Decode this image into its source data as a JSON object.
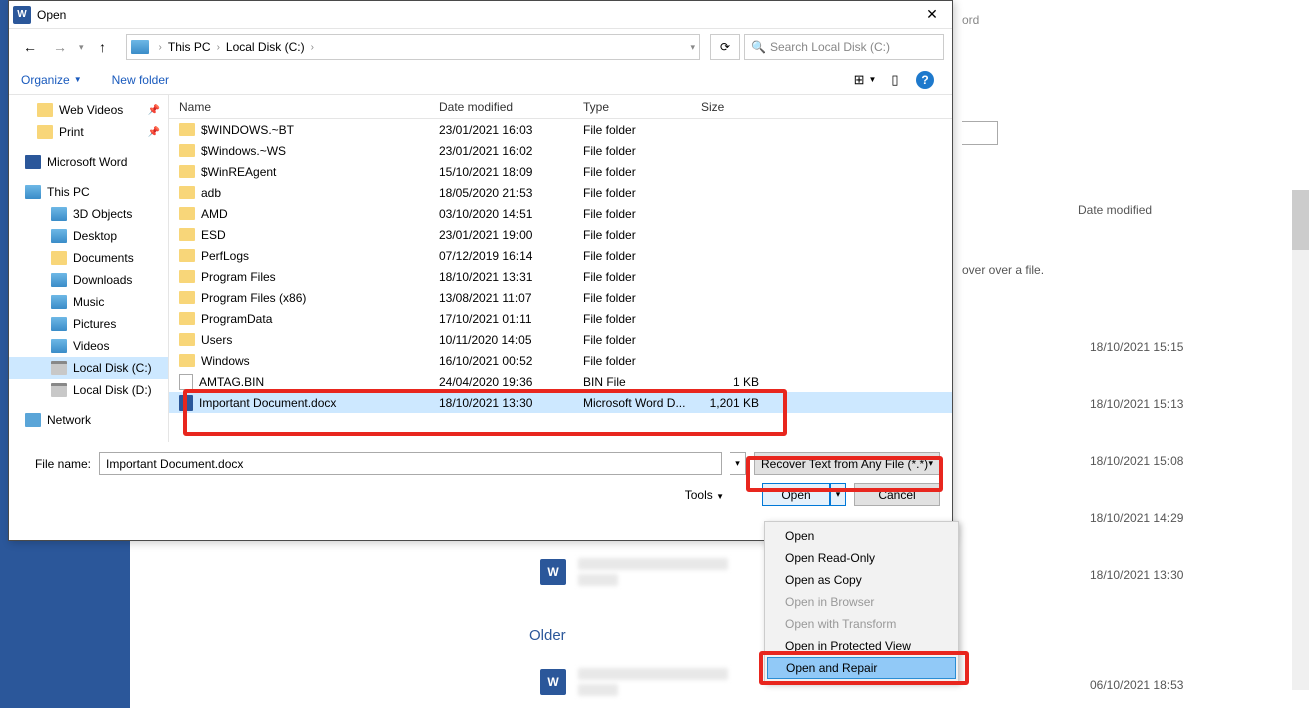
{
  "bg": {
    "app_hint": "ord",
    "col_header": "Date modified",
    "hover_text": "over over a file.",
    "dates": [
      "18/10/2021 15:15",
      "18/10/2021 15:13",
      "18/10/2021 15:08",
      "18/10/2021 14:29",
      "18/10/2021 13:30",
      "06/10/2021 18:53"
    ],
    "older": "Older"
  },
  "dialog": {
    "title": "Open",
    "breadcrumb": {
      "root": "This PC",
      "loc": "Local Disk (C:)"
    },
    "search_placeholder": "Search Local Disk (C:)",
    "toolbar": {
      "organize": "Organize",
      "newfolder": "New folder"
    },
    "columns": {
      "name": "Name",
      "date": "Date modified",
      "type": "Type",
      "size": "Size"
    },
    "tree": {
      "webvideos": "Web Videos",
      "print": "Print",
      "msword": "Microsoft Word",
      "thispc": "This PC",
      "obj3d": "3D Objects",
      "desktop": "Desktop",
      "documents": "Documents",
      "downloads": "Downloads",
      "music": "Music",
      "pictures": "Pictures",
      "videos": "Videos",
      "diskc": "Local Disk (C:)",
      "diskd": "Local Disk (D:)",
      "network": "Network"
    },
    "files": [
      {
        "name": "$WINDOWS.~BT",
        "date": "23/01/2021 16:03",
        "type": "File folder",
        "size": "",
        "icon": "folder"
      },
      {
        "name": "$Windows.~WS",
        "date": "23/01/2021 16:02",
        "type": "File folder",
        "size": "",
        "icon": "folder"
      },
      {
        "name": "$WinREAgent",
        "date": "15/10/2021 18:09",
        "type": "File folder",
        "size": "",
        "icon": "folder"
      },
      {
        "name": "adb",
        "date": "18/05/2020 21:53",
        "type": "File folder",
        "size": "",
        "icon": "folder"
      },
      {
        "name": "AMD",
        "date": "03/10/2020 14:51",
        "type": "File folder",
        "size": "",
        "icon": "folder"
      },
      {
        "name": "ESD",
        "date": "23/01/2021 19:00",
        "type": "File folder",
        "size": "",
        "icon": "folder"
      },
      {
        "name": "PerfLogs",
        "date": "07/12/2019 16:14",
        "type": "File folder",
        "size": "",
        "icon": "folder"
      },
      {
        "name": "Program Files",
        "date": "18/10/2021 13:31",
        "type": "File folder",
        "size": "",
        "icon": "folder"
      },
      {
        "name": "Program Files (x86)",
        "date": "13/08/2021 11:07",
        "type": "File folder",
        "size": "",
        "icon": "folder"
      },
      {
        "name": "ProgramData",
        "date": "17/10/2021 01:11",
        "type": "File folder",
        "size": "",
        "icon": "folder"
      },
      {
        "name": "Users",
        "date": "10/11/2020 14:05",
        "type": "File folder",
        "size": "",
        "icon": "folder"
      },
      {
        "name": "Windows",
        "date": "16/10/2021 00:52",
        "type": "File folder",
        "size": "",
        "icon": "folder"
      },
      {
        "name": "AMTAG.BIN",
        "date": "24/04/2020 19:36",
        "type": "BIN File",
        "size": "1 KB",
        "icon": "file"
      },
      {
        "name": "Important Document.docx",
        "date": "18/10/2021 13:30",
        "type": "Microsoft Word D...",
        "size": "1,201 KB",
        "icon": "word",
        "selected": true
      }
    ],
    "footer": {
      "filename_label": "File name:",
      "filename_value": "Important Document.docx",
      "filter": "Recover Text from Any File (*.*)",
      "tools": "Tools",
      "open": "Open",
      "cancel": "Cancel"
    }
  },
  "openmenu": {
    "open": "Open",
    "readonly": "Open Read-Only",
    "copy": "Open as Copy",
    "browser": "Open in Browser",
    "transform": "Open with Transform",
    "protected": "Open in Protected View",
    "repair": "Open and Repair"
  }
}
